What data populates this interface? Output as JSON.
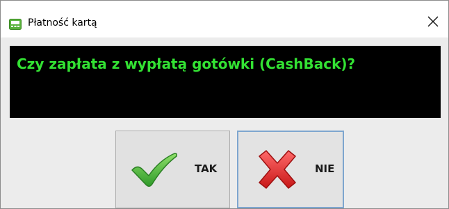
{
  "window": {
    "title": "Płatność kartą",
    "icon": "payment-terminal-icon"
  },
  "prompt": {
    "text": "Czy zapłata z wypłatą gotówki (CashBack)?",
    "text_color": "#33e233",
    "background": "#000000"
  },
  "buttons": {
    "yes_label": "TAK",
    "yes_icon": "checkmark-icon",
    "no_label": "NIE",
    "no_icon": "cross-icon"
  },
  "colors": {
    "check_green": "#3cb83c",
    "cross_red": "#e53030",
    "focus_border": "#7ea6cf"
  }
}
